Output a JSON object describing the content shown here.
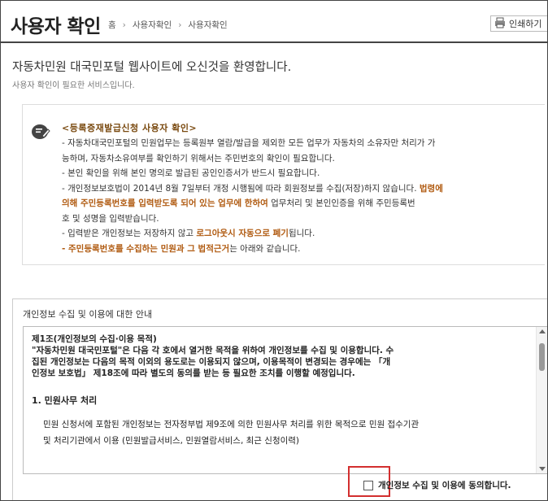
{
  "header": {
    "title": "사용자 확인",
    "breadcrumb": [
      "홈",
      "사용자확인",
      "사용자확인"
    ],
    "print_label": "인쇄하기"
  },
  "welcome": {
    "title": "자동차민원 대국민포털 웹사이트에 오신것을 환영합니다.",
    "subtitle": "사용자 확인이 필요한 서비스입니다."
  },
  "notice": {
    "title": "<등록증재발급신청 사용자 확인>",
    "lines": [
      [
        {
          "t": "- 자동차대국민포털의 민원업무는 등록원부 열람/발급을 제외한 모든 업무가 자동차의 소유자만 처리가 가"
        }
      ],
      [
        {
          "t": "능하며, 자동차소유여부를 확인하기 위해서는 주민번호의 확인이 필요합니다."
        }
      ],
      [
        {
          "t": "- 본인 확인을 위해 본인 명의로 발급된 공인인증서가 반드시 필요합니다."
        }
      ],
      [
        {
          "t": "- 개인정보보호법이 2014년 8월 7일부터 개정 시행됨에 따라 회원정보를 수집(저장)하지 않습니다. "
        },
        {
          "t": "법령에",
          "s": "accent"
        }
      ],
      [
        {
          "t": "의해 주민등록번호를 입력받도록 되어 있는 업무에 한하여",
          "s": "accent"
        },
        {
          "t": " 업무처리 및 본인인증을 위해 주민등록번"
        }
      ],
      [
        {
          "t": "호 및 성명을 입력받습니다."
        }
      ],
      [
        {
          "t": "- 입력받은 개인정보는 저장하지 않고 "
        },
        {
          "t": "로그아웃시 자동으로 폐기",
          "s": "accent"
        },
        {
          "t": "됩니다."
        }
      ],
      [
        {
          "t": "- 주민등록번호를 수집하는 민원과 그 법적근거",
          "s": "accent"
        },
        {
          "t": "는 아래와 같습니다."
        }
      ]
    ]
  },
  "consent": {
    "title": "개인정보 수집 및 이용에 대한 안내",
    "terms_lines": [
      "제1조(개인정보의 수집·이용 목적)",
      "\"자동차민원 대국민포털\"은 다음 각 호에서 열거한 목적을 위하여 개인정보를 수집 및 이용합니다. 수",
      "집된 개인정보는 다음의 목적 이외의 용도로는 이용되지 않으며, 이용목적이 변경되는 경우에는 「개",
      "인정보 보호법」 제18조에 따라 별도의 동의를 받는 등 필요한 조치를 이행할 예정입니다."
    ],
    "section_head": "1. 민원사무 처리",
    "section_body": [
      "민원 신청서에 포함된 개인정보는 전자정부법 제9조에 의한 민원사무 처리를 위한 목적으로 민원 접수기관",
      "및 처리기관에서 이용 (민원발급서비스, 민원열람서비스, 최근 신청이력)"
    ],
    "agree_label": "개인정보 수집 및 이용에 동의합니다."
  },
  "colors": {
    "accent": "#b05a10",
    "highlight": "#d32f2f"
  }
}
